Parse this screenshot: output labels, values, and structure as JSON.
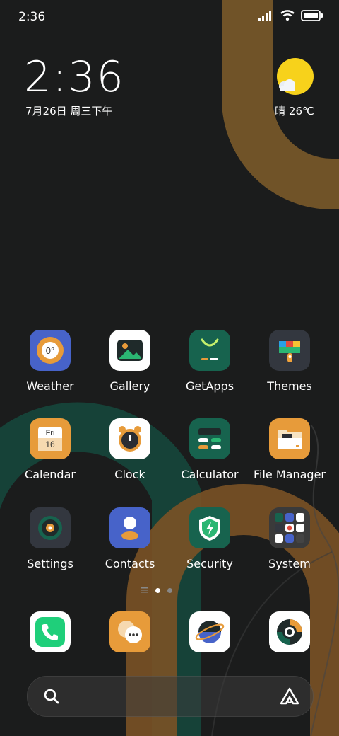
{
  "status_bar": {
    "time": "2:36"
  },
  "clock_widget": {
    "time": "2:36",
    "date": "7月26日 周三下午"
  },
  "weather_widget": {
    "text": "晴 26℃"
  },
  "apps": [
    {
      "label": "Weather",
      "icon": "weather-icon"
    },
    {
      "label": "Gallery",
      "icon": "gallery-icon"
    },
    {
      "label": "GetApps",
      "icon": "getapps-icon"
    },
    {
      "label": "Themes",
      "icon": "themes-icon"
    },
    {
      "label": "Calendar",
      "icon": "calendar-icon",
      "icon_day": "Fri",
      "icon_date": "16"
    },
    {
      "label": "Clock",
      "icon": "clock-icon"
    },
    {
      "label": "Calculator",
      "icon": "calculator-icon"
    },
    {
      "label": "File Manager",
      "icon": "file-manager-icon"
    },
    {
      "label": "Settings",
      "icon": "settings-icon"
    },
    {
      "label": "Contacts",
      "icon": "contacts-icon"
    },
    {
      "label": "Security",
      "icon": "security-icon"
    },
    {
      "label": "System",
      "icon": "system-folder-icon"
    }
  ],
  "weather_icon_text": "0°",
  "dock": [
    {
      "name": "phone",
      "icon": "phone-icon"
    },
    {
      "name": "messaging",
      "icon": "messaging-icon"
    },
    {
      "name": "browser",
      "icon": "browser-icon"
    },
    {
      "name": "camera",
      "icon": "camera-icon"
    }
  ],
  "colors": {
    "background": "#1b1c1c",
    "accent_orange": "#e79b3a",
    "accent_green": "#1c5a4a",
    "weather_blue": "#4763c9"
  }
}
